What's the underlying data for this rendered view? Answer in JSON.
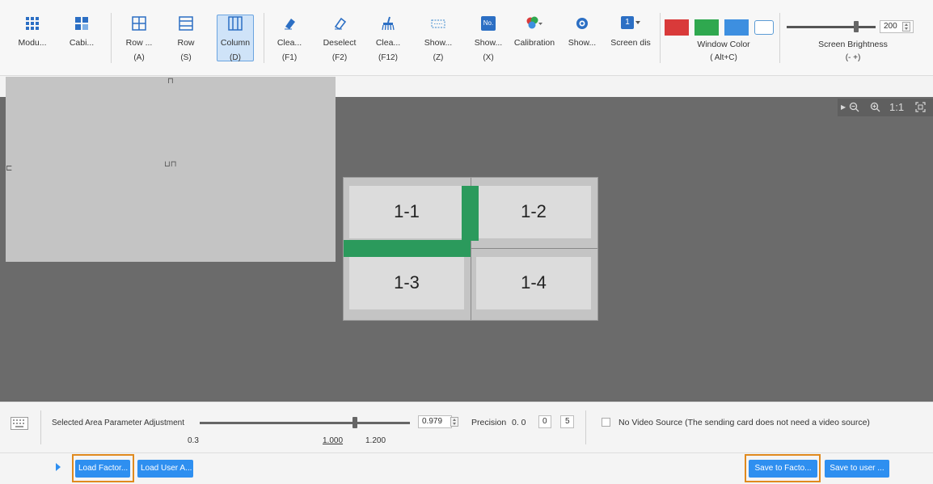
{
  "toolbar": {
    "items": [
      {
        "label": "Modu...",
        "key": "",
        "icon": "grid-four-icon"
      },
      {
        "label": "Cabi...",
        "key": "",
        "icon": "cabinet-icon"
      },
      {
        "label": "Row ...",
        "key": "(A)",
        "icon": "row-grid-icon"
      },
      {
        "label": "Row",
        "key": "(S)",
        "icon": "row-lines-icon"
      },
      {
        "label": "Column",
        "key": "(D)",
        "icon": "column-icon",
        "active": true
      },
      {
        "label": "Clea...",
        "key": "(F1)",
        "icon": "eraser-icon"
      },
      {
        "label": "Deselect",
        "key": "(F2)",
        "icon": "eraser-outline-icon"
      },
      {
        "label": "Clea...",
        "key": "(F12)",
        "icon": "broom-icon"
      },
      {
        "label": "Show...",
        "key": "(Z)",
        "icon": "dotted-rect-icon"
      },
      {
        "label": "Show...",
        "key": "(X)",
        "icon": "number-badge-icon"
      },
      {
        "label": "Calibration",
        "key": "",
        "icon": "color-palette-icon"
      },
      {
        "label": "Show...",
        "key": "",
        "icon": "eye-icon"
      },
      {
        "label": "Screen dis",
        "key": "",
        "icon": "screen-number-icon"
      }
    ],
    "no_badge": "No.",
    "screen_badge": "1",
    "window_color": {
      "label": "Window Color",
      "key": "( Alt+C)",
      "colors": [
        "#d93a3a",
        "#2fa84f",
        "#3d8fe0",
        "#ffffff"
      ]
    },
    "brightness": {
      "label": "Screen Brightness",
      "key": "(-  +)",
      "value": "200",
      "level": 0.78
    }
  },
  "canvas": {
    "cabinets": [
      "1-1",
      "1-2",
      "1-3",
      "1-4"
    ],
    "panel_marks": [
      "⊓",
      "⊏",
      "⊔⊓"
    ],
    "zoom": {
      "fit": "1:1"
    },
    "highlight_color": "#2b9a5c"
  },
  "params": {
    "label": "Selected Area Parameter Adjustment",
    "min": "0.3",
    "current": "1.000",
    "max": "1.200",
    "value": "0.979",
    "precision_label": "Precision",
    "precision_text": "0. 0",
    "precision_a": "0",
    "precision_b": "5",
    "no_video_label": "No Video Source (The sending card does not need a video source)"
  },
  "actions": {
    "load_factory": "Load Factor...",
    "load_user": "Load User A...",
    "save_factory": "Save to Facto...",
    "save_user": "Save to user ..."
  }
}
